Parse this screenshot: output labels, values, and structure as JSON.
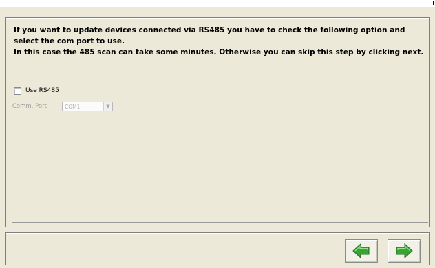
{
  "intro": {
    "line1": "If you want to update devices connected via RS485 you have to check the following option and select the com port to use.",
    "line2": "In this case the 485 scan can take some minutes. Otherwise you can skip this step by clicking next."
  },
  "rs485": {
    "label": "Use RS485",
    "checked": false
  },
  "port": {
    "label": "Comm. Port",
    "selected": "COM1",
    "disabled": true
  },
  "navigation": {
    "back_icon": "green-left-arrow-icon",
    "next_icon": "green-right-arrow-icon",
    "arrow_color": "#3aa335"
  }
}
